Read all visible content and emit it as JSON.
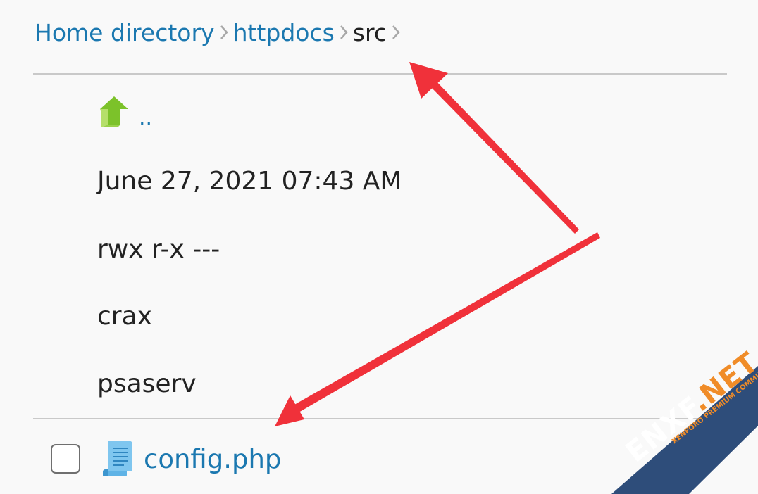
{
  "breadcrumb": {
    "items": [
      {
        "label": "Home directory"
      },
      {
        "label": "httpdocs"
      },
      {
        "label": "src"
      }
    ]
  },
  "parent_dir": {
    "label": ".."
  },
  "details": {
    "modified": "June 27, 2021 07:43 AM",
    "permissions": "rwx r-x ---",
    "owner": "crax",
    "group": "psaserv"
  },
  "file": {
    "name": "config.php",
    "checked": false
  },
  "icons": {
    "parent": "up-arrow-icon",
    "file": "php-file-icon",
    "separator": "chevron-right-icon"
  },
  "colors": {
    "link": "#1b78b0",
    "text": "#222222",
    "annotation_arrow": "#f0313a",
    "up_arrow": "#7cc22a"
  },
  "watermark": {
    "main_left": "ENXF",
    "main_right": ".NET",
    "sub": "XENFORO PREMIUM COMMUNITY"
  }
}
